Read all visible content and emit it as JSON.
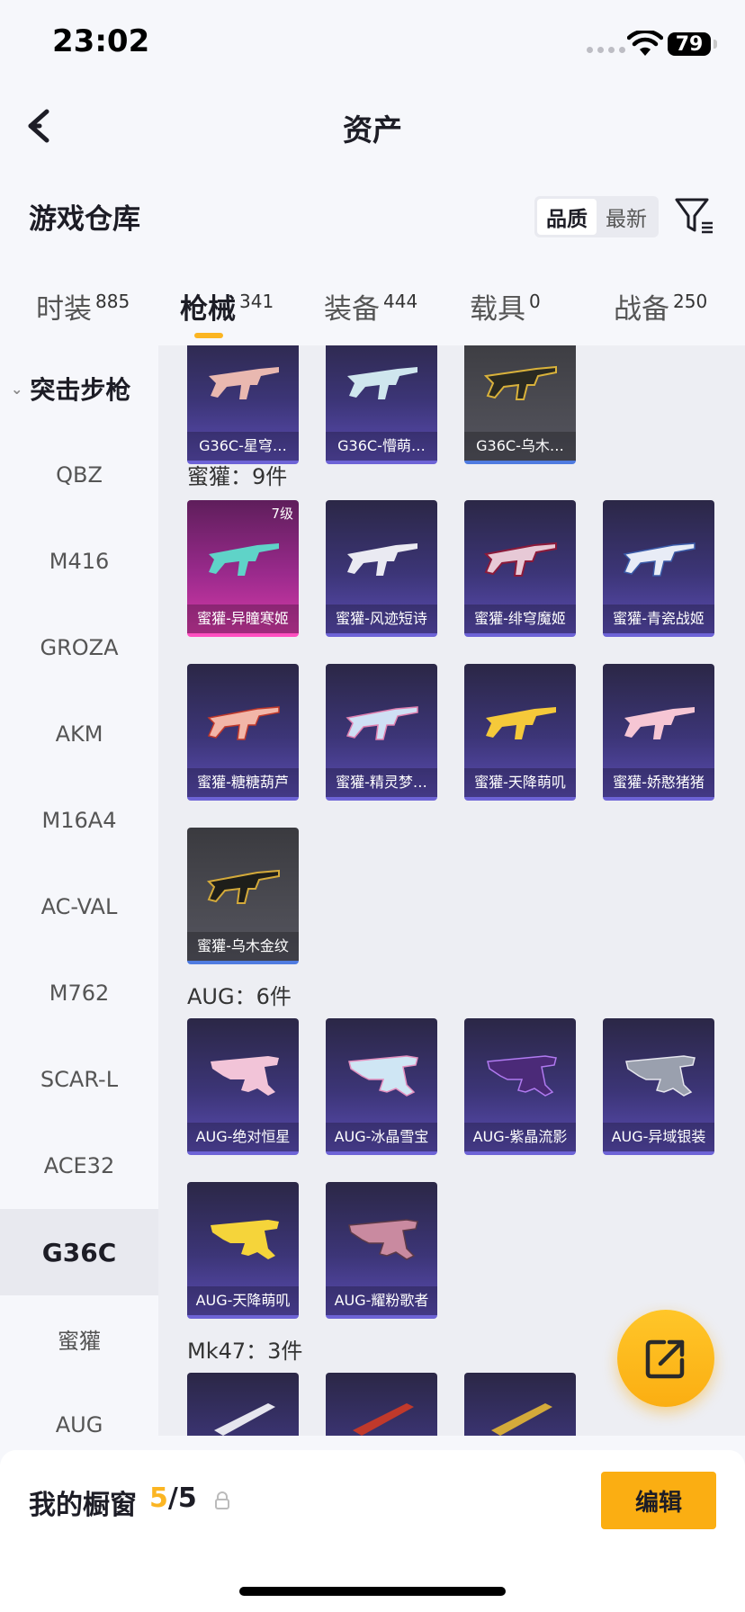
{
  "status": {
    "time": "23:02",
    "battery": "79"
  },
  "nav": {
    "title": "资产"
  },
  "warehouse": {
    "title": "游戏仓库",
    "sort_quality": "品质",
    "sort_newest": "最新"
  },
  "tabs": [
    {
      "label": "时装",
      "count": "885"
    },
    {
      "label": "枪械",
      "count": "341"
    },
    {
      "label": "装备",
      "count": "444"
    },
    {
      "label": "载具",
      "count": "0"
    },
    {
      "label": "战备",
      "count": "250"
    }
  ],
  "sidebar": {
    "category": "突击步枪",
    "items": [
      "QBZ",
      "M416",
      "GROZA",
      "AKM",
      "M16A4",
      "AC-VAL",
      "M762",
      "SCAR-L",
      "ACE32",
      "G36C",
      "蜜獾",
      "AUG"
    ]
  },
  "groups": {
    "g36c": {
      "items": [
        {
          "name": "G36C-星穹…",
          "style": "purple"
        },
        {
          "name": "G36C-懵萌…",
          "style": "purple"
        },
        {
          "name": "G36C-乌木…",
          "style": "gray"
        }
      ]
    },
    "honey_badger": {
      "label": "蜜獾：9件",
      "items": [
        {
          "name": "蜜獾-异瞳寒姬",
          "style": "pink",
          "level": "7级"
        },
        {
          "name": "蜜獾-风迹短诗",
          "style": "purple"
        },
        {
          "name": "蜜獾-绯穹魔姬",
          "style": "purple"
        },
        {
          "name": "蜜獾-青瓷战姬",
          "style": "purple"
        },
        {
          "name": "蜜獾-糖糖葫芦",
          "style": "purple"
        },
        {
          "name": "蜜獾-精灵梦…",
          "style": "purple"
        },
        {
          "name": "蜜獾-天降萌叽",
          "style": "purple"
        },
        {
          "name": "蜜獾-娇憨猪猪",
          "style": "purple"
        },
        {
          "name": "蜜獾-乌木金纹",
          "style": "gray"
        }
      ]
    },
    "aug": {
      "label": "AUG：6件",
      "items": [
        {
          "name": "AUG-绝对恒星",
          "style": "purple"
        },
        {
          "name": "AUG-冰晶雪宝",
          "style": "purple"
        },
        {
          "name": "AUG-紫晶流影",
          "style": "purple"
        },
        {
          "name": "AUG-异域银装",
          "style": "purple"
        },
        {
          "name": "AUG-天降萌叽",
          "style": "purple"
        },
        {
          "name": "AUG-耀粉歌者",
          "style": "purple"
        }
      ]
    },
    "mk47": {
      "label": "Mk47：3件"
    }
  },
  "showcase": {
    "label": "我的橱窗",
    "current": "5",
    "total": "/5",
    "edit": "编辑"
  }
}
